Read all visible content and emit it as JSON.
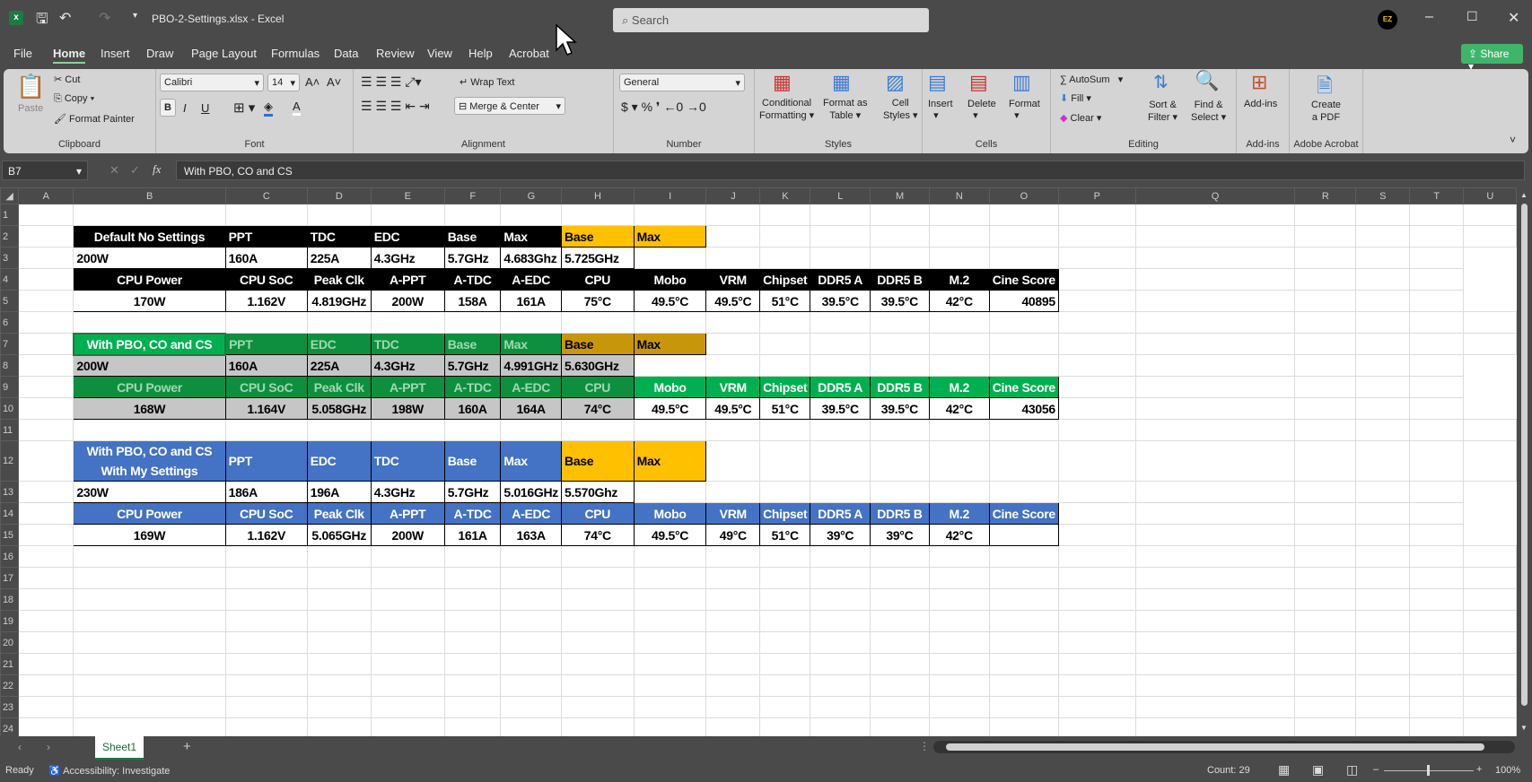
{
  "window": {
    "file_title": "PBO-2-Settings.xlsx - Excel",
    "search_placeholder": "Search",
    "avatar_initials": "EZ"
  },
  "menu": {
    "tabs": [
      "File",
      "Home",
      "Insert",
      "Draw",
      "Page Layout",
      "Formulas",
      "Data",
      "Review",
      "View",
      "Help",
      "Acrobat"
    ],
    "active": "Home",
    "share": "Share"
  },
  "ribbon": {
    "clipboard": {
      "paste": "Paste",
      "cut": "Cut",
      "copy": "Copy",
      "format_painter": "Format Painter",
      "label": "Clipboard"
    },
    "font": {
      "name": "Calibri",
      "size": "14",
      "label": "Font",
      "bold": "B",
      "italic": "I",
      "underline": "U"
    },
    "alignment": {
      "wrap": "Wrap Text",
      "merge": "Merge & Center",
      "label": "Alignment"
    },
    "number": {
      "format": "General",
      "label": "Number"
    },
    "styles": {
      "conditional": [
        "Conditional",
        "Formatting"
      ],
      "table": [
        "Format as",
        "Table"
      ],
      "cell": [
        "Cell",
        "Styles"
      ],
      "label": "Styles"
    },
    "cells": {
      "insert": "Insert",
      "delete": "Delete",
      "format": "Format",
      "label": "Cells"
    },
    "editing": {
      "autosum": "AutoSum",
      "fill": "Fill",
      "clear": "Clear",
      "sort": [
        "Sort &",
        "Filter"
      ],
      "find": [
        "Find &",
        "Select"
      ],
      "label": "Editing"
    },
    "addins": {
      "button": "Add-ins",
      "label": "Add-ins"
    },
    "acrobat": {
      "button": [
        "Create",
        "a PDF"
      ],
      "label": "Adobe Acrobat"
    }
  },
  "formula_bar": {
    "name_box": "B7",
    "formula": "With PBO, CO and CS"
  },
  "columns": [
    "A",
    "B",
    "C",
    "D",
    "E",
    "F",
    "G",
    "H",
    "I",
    "J",
    "K",
    "L",
    "M",
    "N",
    "O",
    "P",
    "Q",
    "R",
    "S",
    "T",
    "U"
  ],
  "colors": {
    "black": "#000000",
    "green": "#00b050",
    "green_selected": "#0e8f3e",
    "blue": "#4472c4",
    "orange": "#ffc000",
    "orange_selected": "#c8960a",
    "selected_fill": "#c6c6c6"
  },
  "blocks": [
    {
      "label": [
        "Default No Settings"
      ],
      "theme": "black",
      "header1": [
        "PPT",
        "TDC",
        "EDC",
        "Base",
        "Max",
        "Base",
        "Max"
      ],
      "values1": [
        "200W",
        "160A",
        "225A",
        "4.3GHz",
        "5.7GHz",
        "4.683Ghz",
        "5.725GHz"
      ],
      "header2": [
        "CPU Power",
        "CPU SoC",
        "Peak Clk",
        "A-PPT",
        "A-TDC",
        "A-EDC",
        "CPU",
        "Mobo",
        "VRM",
        "Chipset",
        "DDR5 A",
        "DDR5 B",
        "M.2",
        "Cine Score"
      ],
      "values2": [
        "170W",
        "1.162V",
        "4.819GHz",
        "200W",
        "158A",
        "161A",
        "75°C",
        "49.5°C",
        "49.5°C",
        "51°C",
        "39.5°C",
        "39.5°C",
        "42°C",
        "40895"
      ]
    },
    {
      "label": [
        "With PBO, CO and CS"
      ],
      "theme": "green",
      "header1": [
        "PPT",
        "EDC",
        "TDC",
        "Base",
        "Max",
        "Base",
        "Max"
      ],
      "values1": [
        "200W",
        "160A",
        "225A",
        "4.3GHz",
        "5.7GHz",
        "4.991GHz",
        "5.630GHz"
      ],
      "header2": [
        "CPU Power",
        "CPU SoC",
        "Peak Clk",
        "A-PPT",
        "A-TDC",
        "A-EDC",
        "CPU",
        "Mobo",
        "VRM",
        "Chipset",
        "DDR5 A",
        "DDR5 B",
        "M.2",
        "Cine Score"
      ],
      "values2": [
        "168W",
        "1.164V",
        "5.058GHz",
        "198W",
        "160A",
        "164A",
        "74°C",
        "49.5°C",
        "49.5°C",
        "51°C",
        "39.5°C",
        "39.5°C",
        "42°C",
        "43056"
      ]
    },
    {
      "label": [
        "With PBO, CO and CS",
        "With My Settings"
      ],
      "theme": "blue",
      "header1": [
        "PPT",
        "EDC",
        "TDC",
        "Base",
        "Max",
        "Base",
        "Max"
      ],
      "values1": [
        "230W",
        "186A",
        "196A",
        "4.3GHz",
        "5.7GHz",
        "5.016GHz",
        "5.570Ghz"
      ],
      "header2": [
        "CPU Power",
        "CPU SoC",
        "Peak Clk",
        "A-PPT",
        "A-TDC",
        "A-EDC",
        "CPU",
        "Mobo",
        "VRM",
        "Chipset",
        "DDR5 A",
        "DDR5 B",
        "M.2",
        "Cine Score"
      ],
      "values2": [
        "169W",
        "1.162V",
        "5.065GHz",
        "200W",
        "161A",
        "163A",
        "74°C",
        "49.5°C",
        "49°C",
        "51°C",
        "39°C",
        "39°C",
        "42°C",
        ""
      ]
    }
  ],
  "sheet_tabs": [
    "Sheet1"
  ],
  "status": {
    "ready": "Ready",
    "accessibility": "Accessibility: Investigate",
    "count": "Count: 29",
    "zoom": "100%"
  }
}
